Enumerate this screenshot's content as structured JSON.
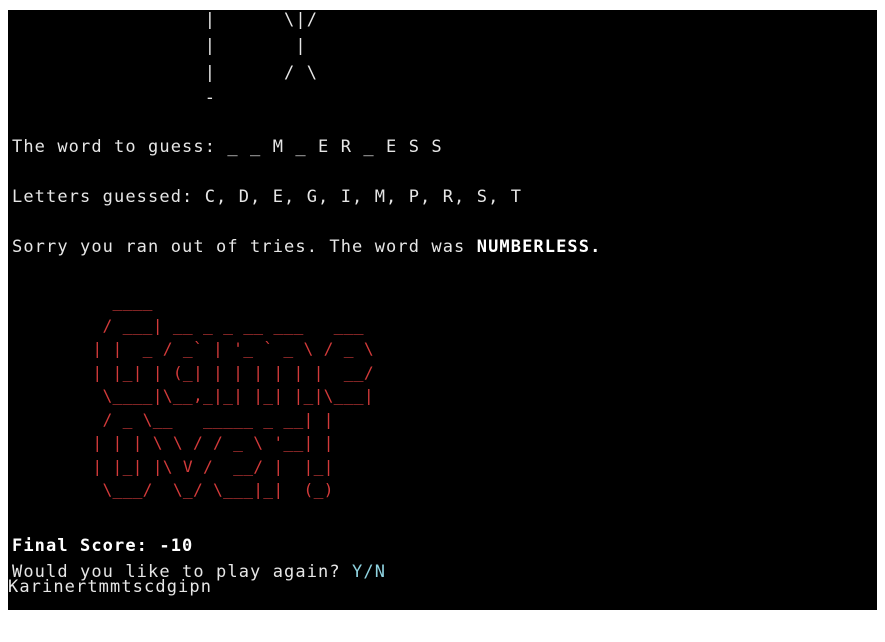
{
  "gallows": [
    "                 |      \\|/",
    "                 |       |",
    "                 |      / \\",
    "                 -"
  ],
  "word_prompt": "The word to guess: _ _ M _ E R _ E S S",
  "letters_prompt": "Letters guessed: C, D, E, G, I, M, P, R, S, T",
  "loss_message_prefix": "Sorry you ran out of tries. The word was ",
  "secret_word": "NUMBERLESS.",
  "game_over_art": "          ____\n         / ___| __ _ _ __ ___   ___\n        | |  _ / _` | '_ ` _ \\ / _ \\\n        | |_| | (_| | | | | | |  __/\n         \\____|\\__,_|_| |_| |_|\\___|\n         / _ \\__   _____ _ __| |\n        | | | \\ \\ / / _ \\ '__| |\n        | |_| |\\ V /  __/ |  |_|\n         \\___/  \\_/ \\___|_|  (_)",
  "final_score_label": "Final Score: -10",
  "play_again_prompt": "Would you like to play again? ",
  "play_again_options": "Y/N",
  "input_value": "Karinertmmtscdgipn"
}
